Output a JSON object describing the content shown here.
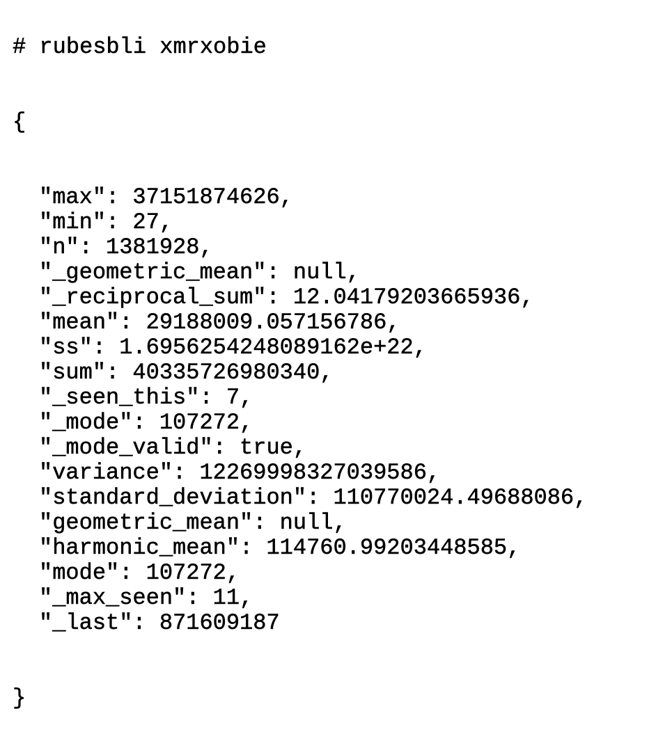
{
  "header_comment": "# rubesbli xmrxobie",
  "open_brace": "{",
  "close_brace": "}",
  "entries": [
    {
      "key": "\"max\": ",
      "value": "37151874626,"
    },
    {
      "key": "\"min\": ",
      "value": "27,"
    },
    {
      "key": "\"n\": ",
      "value": "1381928,"
    },
    {
      "key": "\"_geometric_mean\": ",
      "value": "null,"
    },
    {
      "key": "\"_reciprocal_sum\": ",
      "value": "12.04179203665936,"
    },
    {
      "key": "\"mean\": ",
      "value": "29188009.057156786,"
    },
    {
      "key": "\"ss\": ",
      "value": "1.6956254248089162e+22,"
    },
    {
      "key": "\"sum\": ",
      "value": "40335726980340,"
    },
    {
      "key": "\"_seen_this\": ",
      "value": "7,"
    },
    {
      "key": "\"_mode\": ",
      "value": "107272,"
    },
    {
      "key": "\"_mode_valid\": ",
      "value": "true,"
    },
    {
      "key": "\"variance\": ",
      "value": "12269998327039586,"
    },
    {
      "key": "\"standard_deviation\": ",
      "value": "110770024.49688086,"
    },
    {
      "key": "\"geometric_mean\": ",
      "value": "null,"
    },
    {
      "key": "\"harmonic_mean\": ",
      "value": "114760.99203448585,"
    },
    {
      "key": "\"mode\": ",
      "value": "107272,"
    },
    {
      "key": "\"_max_seen\": ",
      "value": "11,"
    },
    {
      "key": "\"_last\": ",
      "value": "871609187"
    }
  ]
}
